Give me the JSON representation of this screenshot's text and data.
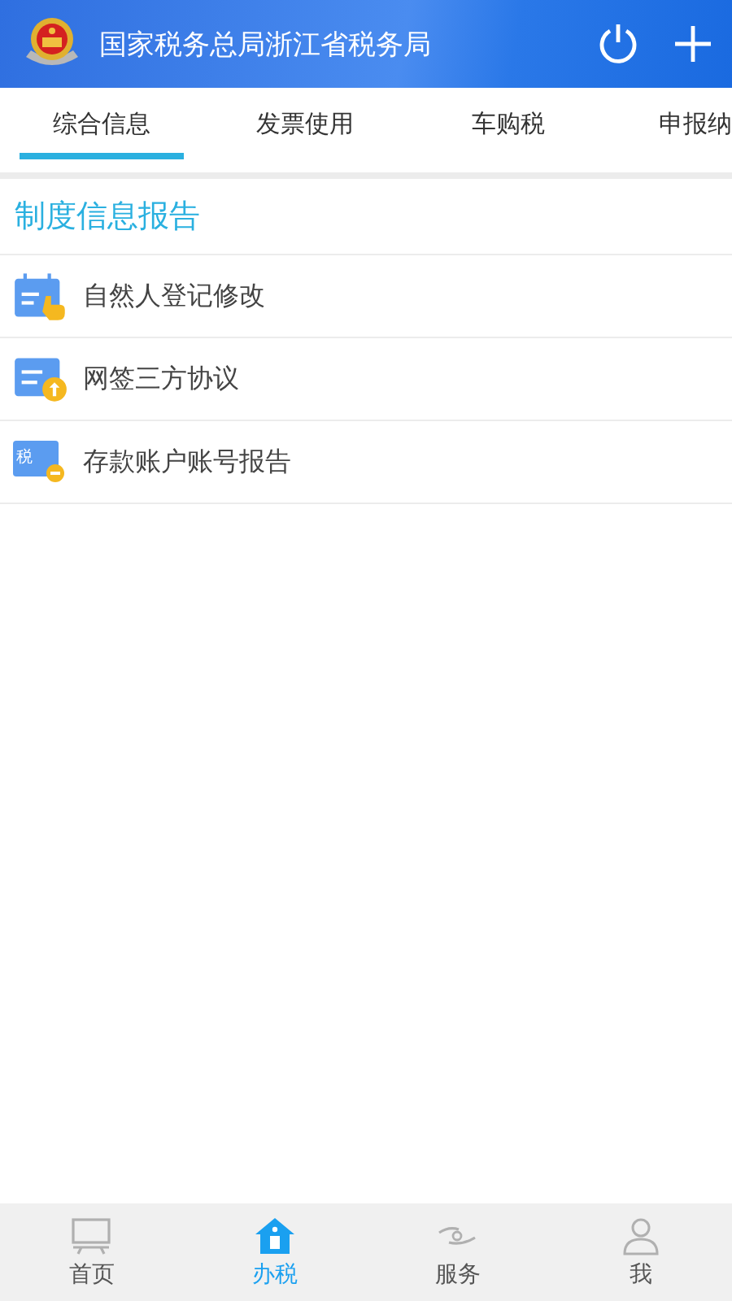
{
  "header": {
    "title": "国家税务总局浙江省税务局"
  },
  "tabs": [
    {
      "label": "综合信息",
      "selected": true
    },
    {
      "label": "发票使用",
      "selected": false
    },
    {
      "label": "车购税",
      "selected": false
    },
    {
      "label": "申报纳",
      "selected": false
    }
  ],
  "section": {
    "title": "制度信息报告"
  },
  "items": [
    {
      "label": "自然人登记修改",
      "kind": "calendar"
    },
    {
      "label": "网签三方协议",
      "kind": "upload"
    },
    {
      "label": "存款账户账号报告",
      "kind": "tax",
      "icon_text": "税"
    }
  ],
  "bottom_nav": [
    {
      "label": "首页",
      "kind": "home",
      "selected": false
    },
    {
      "label": "办税",
      "kind": "office",
      "selected": true
    },
    {
      "label": "服务",
      "kind": "service",
      "selected": false
    },
    {
      "label": "我",
      "kind": "me",
      "selected": false
    }
  ]
}
